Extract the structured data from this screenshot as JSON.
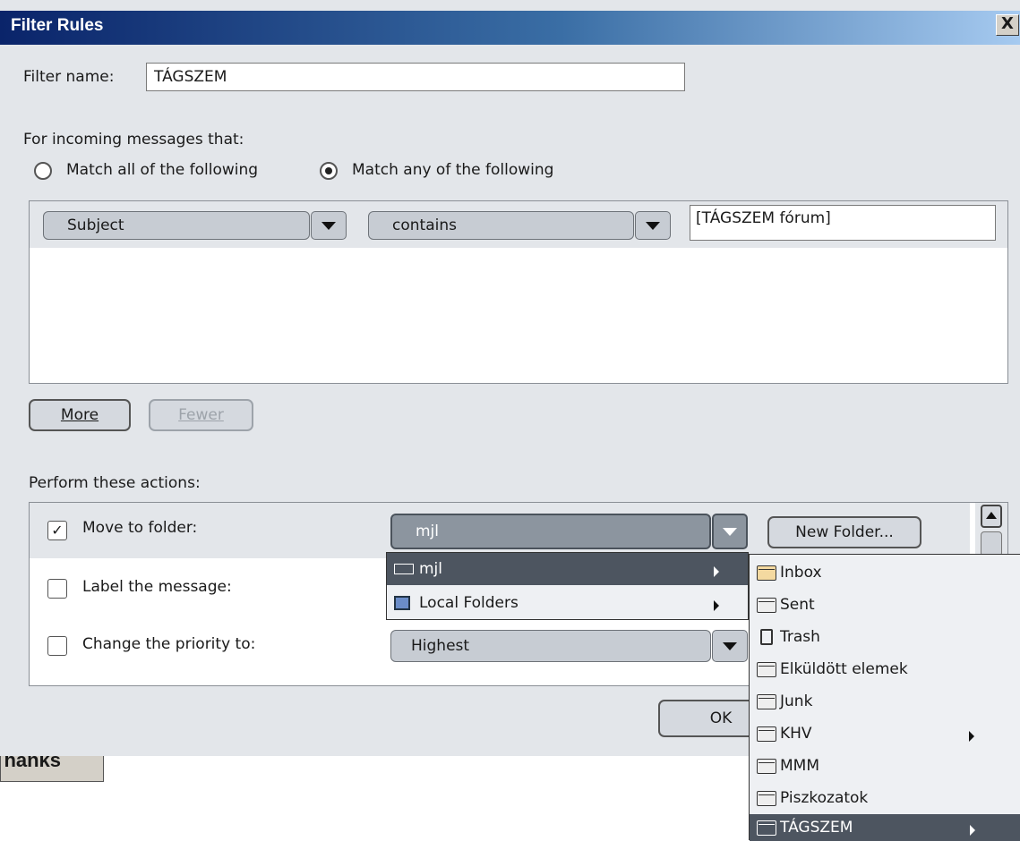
{
  "dialog": {
    "title": "Filter Rules",
    "close_label": "X",
    "filter_name_label": "Filter name:",
    "filter_name_value": "TÁGSZEM",
    "incoming_label": "For incoming messages that:",
    "match_all_label": "Match all of the following",
    "match_any_label": "Match any of the following",
    "match_any_selected": true,
    "criteria": {
      "field": "Subject",
      "operator": "contains",
      "value": "[TÁGSZEM fórum]"
    },
    "more_label": "More",
    "fewer_label": "Fewer",
    "actions_label": "Perform these actions:",
    "actions": [
      {
        "label": "Move to folder:",
        "checked": true,
        "value": "mjl"
      },
      {
        "label": "Label the message:",
        "checked": false
      },
      {
        "label": "Change the priority to:",
        "checked": false,
        "value": "Highest"
      }
    ],
    "new_folder_label": "New Folder...",
    "ok_label": "OK"
  },
  "background_text": "Thanks",
  "account_menu": [
    {
      "label": "mjl",
      "icon": "mail-account-icon",
      "highlighted": true,
      "has_submenu": true
    },
    {
      "label": "Local Folders",
      "icon": "computer-icon",
      "highlighted": false,
      "has_submenu": true
    }
  ],
  "folder_menu": [
    {
      "label": "Inbox",
      "icon": "inbox-icon"
    },
    {
      "label": "Sent",
      "icon": "sent-icon"
    },
    {
      "label": "Trash",
      "icon": "trash-icon"
    },
    {
      "label": "Elküldött elemek",
      "icon": "folder-icon"
    },
    {
      "label": "Junk",
      "icon": "folder-icon"
    },
    {
      "label": "KHV",
      "icon": "folder-icon",
      "has_submenu": true
    },
    {
      "label": "MMM",
      "icon": "folder-icon"
    },
    {
      "label": "Piszkozatok",
      "icon": "folder-icon"
    },
    {
      "label": "TÁGSZEM",
      "icon": "folder-icon",
      "has_submenu": true,
      "highlighted": true
    }
  ],
  "colors": {
    "titlebar_start": "#0a246a",
    "dialog_bg": "#e3e6ea",
    "highlight": "#4d5560"
  }
}
